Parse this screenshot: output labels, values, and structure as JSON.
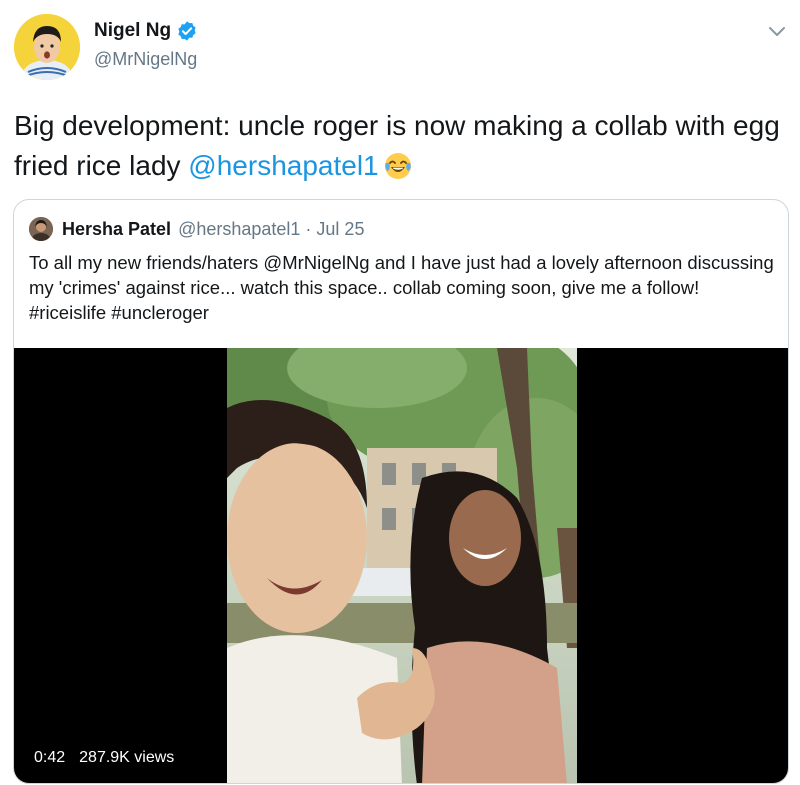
{
  "author": {
    "display_name": "Nigel Ng",
    "handle": "@MrNigelNg",
    "verified": true
  },
  "tweet": {
    "text_before": "Big development: uncle roger is now making a collab with egg fried rice lady ",
    "mention": "@hershapatel1",
    "emoji": "face-with-tears-of-joy"
  },
  "quoted": {
    "display_name": "Hersha Patel",
    "handle": "@hershapatel1",
    "separator": "·",
    "date": "Jul 25",
    "text": "To all my new friends/haters @MrNigelNg and I have just had a lovely afternoon discussing my 'crimes' against rice... watch this space.. collab coming soon, give me a follow! #riceislife #uncleroger"
  },
  "video": {
    "duration": "0:42",
    "views": "287.9K views"
  },
  "colors": {
    "link": "#1b95e0",
    "secondary_text": "#657786",
    "border": "#ccd6dd",
    "verified_badge": "#1da1f2"
  },
  "icons": {
    "menu": "chevron-down-icon",
    "verified": "verified-badge-icon"
  }
}
